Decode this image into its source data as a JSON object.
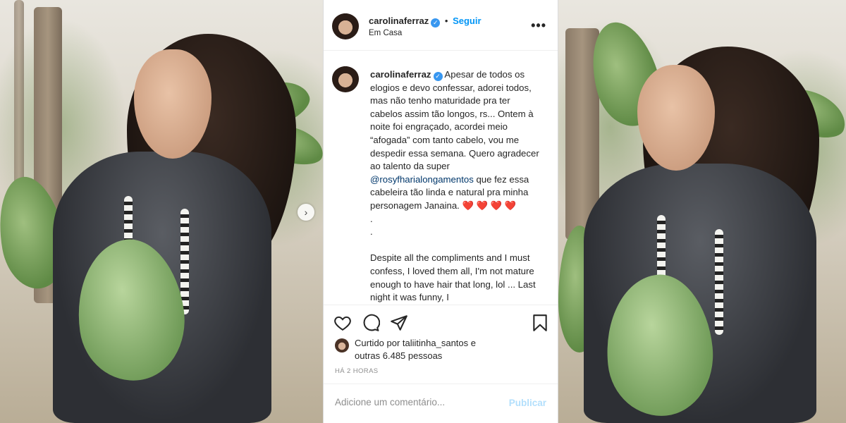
{
  "post": {
    "author": {
      "username": "carolinaferraz",
      "verified": true,
      "follow_label": "Seguir",
      "separator": "•",
      "location": "Em Casa"
    },
    "more_icon": "more-horizontal-icon",
    "caption": {
      "username": "carolinaferraz",
      "text_pt_1": " Apesar de todos os elogios e devo confessar, adorei todos, mas não tenho maturidade pra ter cabelos assim tão longos, rs... Ontem à noite foi engraçado, acordei meio “afogada” com tanto cabelo, vou me despedir essa semana. Quero agradecer ao talento da super ",
      "mention": "@rosyfharialongamentos",
      "text_pt_2": " que fez essa cabeleira tão linda e natural pra minha personagem Janaina. ",
      "hearts": "❤️ ❤️ ❤️ ❤️",
      "dots": ".",
      "dots2": ".",
      "text_en": "Despite all the compliments and I must confess, I loved them all, I'm not mature enough to have hair that long, lol ... Last night it was funny, I"
    },
    "actions": {
      "like_icon": "heart-icon",
      "comment_icon": "comment-icon",
      "share_icon": "send-icon",
      "save_icon": "bookmark-icon"
    },
    "likes": {
      "prefix": "Curtido por ",
      "liker": "taliitinha_santos",
      "middle": " e",
      "others": "outras 6.485 pessoas"
    },
    "timestamp": "HÁ 2 HORAS",
    "comment_box": {
      "placeholder": "Adicione um comentário...",
      "publish_label": "Publicar"
    }
  },
  "carousel": {
    "next_icon": "chevron-right-icon",
    "next_glyph": "›"
  },
  "colors": {
    "accent": "#0095f6",
    "verified": "#3897f0",
    "heart": "#ed4956",
    "publish_disabled": "#b2dffc"
  }
}
